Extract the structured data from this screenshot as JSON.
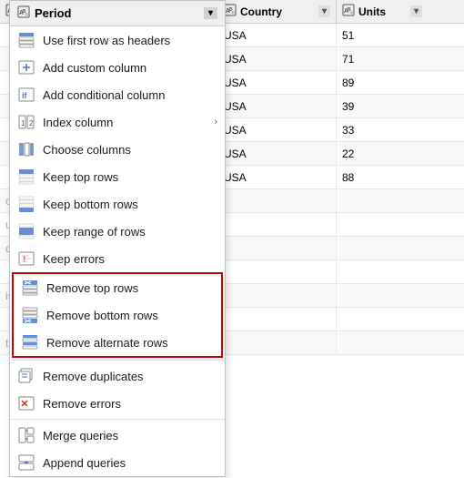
{
  "table": {
    "headers": {
      "period": {
        "label": "Period",
        "type_icon": "ABC"
      },
      "country": {
        "label": "Country",
        "type_icon": "ABC"
      },
      "units": {
        "label": "Units",
        "type_icon": "ABC"
      }
    },
    "rows": [
      {
        "period": "",
        "country": "USA",
        "units": "51"
      },
      {
        "period": "",
        "country": "USA",
        "units": "71"
      },
      {
        "period": "",
        "country": "USA",
        "units": "89"
      },
      {
        "period": "",
        "country": "USA",
        "units": "39"
      },
      {
        "period": "",
        "country": "USA",
        "units": "33"
      },
      {
        "period": "",
        "country": "USA",
        "units": "22"
      },
      {
        "period": "",
        "country": "USA",
        "units": "88"
      },
      {
        "period": "onsect...",
        "country": "",
        "units": ""
      },
      {
        "period": "us risu...",
        "country": "",
        "units": ""
      },
      {
        "period": "din te...",
        "country": "",
        "units": ""
      },
      {
        "period": "",
        "country": "",
        "units": ""
      },
      {
        "period": "ismo...",
        "country": "",
        "units": ""
      },
      {
        "period": "",
        "country": "",
        "units": ""
      },
      {
        "period": "t eget...",
        "country": "",
        "units": ""
      }
    ]
  },
  "menu": {
    "header": "Period",
    "items": [
      {
        "id": "use-first-row",
        "label": "Use first row as headers",
        "icon": "use-first-row-icon",
        "has_submenu": false
      },
      {
        "id": "add-custom-column",
        "label": "Add custom column",
        "icon": "add-custom-icon",
        "has_submenu": false
      },
      {
        "id": "add-conditional-column",
        "label": "Add conditional column",
        "icon": "add-conditional-icon",
        "has_submenu": false
      },
      {
        "id": "index-column",
        "label": "Index column",
        "icon": "index-icon",
        "has_submenu": true
      },
      {
        "id": "choose-columns",
        "label": "Choose columns",
        "icon": "choose-columns-icon",
        "has_submenu": false
      },
      {
        "id": "keep-top-rows",
        "label": "Keep top rows",
        "icon": "keep-top-icon",
        "has_submenu": false
      },
      {
        "id": "keep-bottom-rows",
        "label": "Keep bottom rows",
        "icon": "keep-bottom-icon",
        "has_submenu": false
      },
      {
        "id": "keep-range-of-rows",
        "label": "Keep range of rows",
        "icon": "keep-range-icon",
        "has_submenu": false
      },
      {
        "id": "keep-errors",
        "label": "Keep errors",
        "icon": "keep-errors-icon",
        "has_submenu": false
      },
      {
        "id": "remove-top-rows",
        "label": "Remove top rows",
        "icon": "remove-top-icon",
        "has_submenu": false,
        "highlighted": true
      },
      {
        "id": "remove-bottom-rows",
        "label": "Remove bottom rows",
        "icon": "remove-bottom-icon",
        "has_submenu": false,
        "highlighted": true
      },
      {
        "id": "remove-alternate-rows",
        "label": "Remove alternate rows",
        "icon": "remove-alternate-icon",
        "has_submenu": false,
        "highlighted": true
      },
      {
        "id": "remove-duplicates",
        "label": "Remove duplicates",
        "icon": "remove-duplicates-icon",
        "has_submenu": false
      },
      {
        "id": "remove-errors",
        "label": "Remove errors",
        "icon": "remove-errors-icon",
        "has_submenu": false
      },
      {
        "id": "merge-queries",
        "label": "Merge queries",
        "icon": "merge-queries-icon",
        "has_submenu": false
      },
      {
        "id": "append-queries",
        "label": "Append queries",
        "icon": "append-queries-icon",
        "has_submenu": false
      }
    ]
  }
}
